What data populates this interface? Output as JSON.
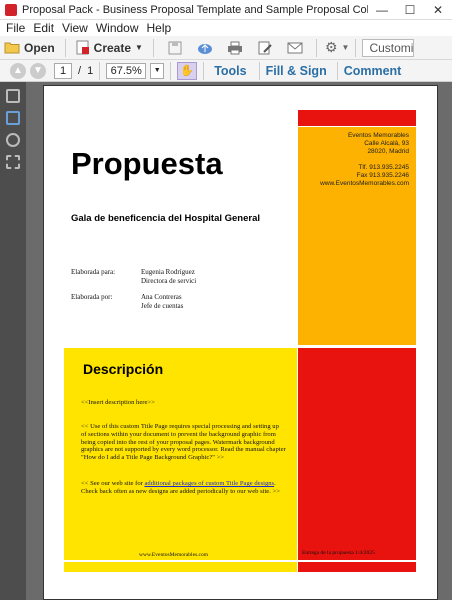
{
  "window": {
    "title": "Proposal Pack - Business Proposal Template and Sample Proposal Collection - Adobe Acrobat Pro",
    "minimize": "—",
    "maximize": "☐",
    "close": "✕"
  },
  "menu": [
    "File",
    "Edit",
    "View",
    "Window",
    "Help"
  ],
  "toolbar": {
    "open_label": "Open",
    "create_label": "Create",
    "customize_label": "Customi"
  },
  "nav": {
    "page_current": "1",
    "page_sep": "/",
    "page_total": "1",
    "zoom": "67.5%",
    "tools": "Tools",
    "fill_sign": "Fill & Sign",
    "comment": "Comment"
  },
  "document": {
    "company_lines": [
      "Eventos Memorables",
      "Calle Alcalá, 93",
      "28020, Madrid"
    ],
    "phone_lines": [
      "Tlf. 913.935.2245",
      "Fax 913.935.2246",
      "www.EventosMemorables.com"
    ],
    "title": "Propuesta",
    "subtitle": "Gala de beneficencia del Hospital General",
    "prepared_for_label": "Elaborada para:",
    "prepared_for_name": "Eugenia Rodríguez",
    "prepared_for_role": "Directora de servici",
    "prepared_by_label": "Elaborada por:",
    "prepared_by_name": "Ana Contreras",
    "prepared_by_role": "Jefe de cuentas",
    "section_title": "Descripción",
    "insert_desc": "<<Insert description here>>",
    "para1": "<< Use of this custom Title Page requires special processing and setting up of sections within your document to prevent the background graphic from being copied into the rest of your proposal pages. Watermark background graphics are not supported by every word processor. Read the manual chapter \"How do I add a Title Page Background Graphic?\" >>",
    "para2_pre": "<< See our web site for ",
    "para2_link": "additional packages of custom Title Page designs",
    "para2_post": ". Check back often as new designs are added periodically to our web site. >>",
    "footer_url": "www.EventosMemorables.com",
    "footer_date": "Entrega de la propuesta 1/4/2025"
  },
  "colors": {
    "red": "#e8130f",
    "orange": "#fdb100",
    "yellow": "#ffe400",
    "accent_blue": "#2b6fa5"
  }
}
